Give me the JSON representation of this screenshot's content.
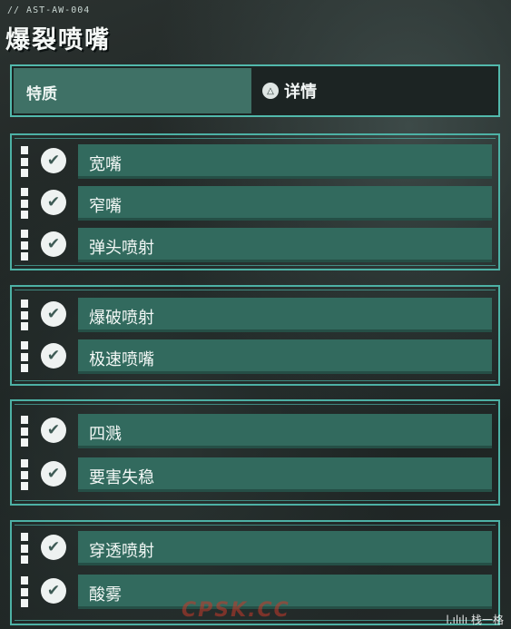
{
  "header": {
    "code": "// AST-AW-004",
    "title": "爆裂喷嘴"
  },
  "tabs": {
    "traits": "特质",
    "details_button_icon": "triangle-icon",
    "details_button_glyph": "△",
    "details": "详情"
  },
  "groups": [
    {
      "items": [
        "宽嘴",
        "窄嘴",
        "弹头喷射"
      ]
    },
    {
      "items": [
        "爆破喷射",
        "极速喷嘴"
      ]
    },
    {
      "items": [
        "四溅",
        "要害失稳"
      ]
    },
    {
      "items": [
        "穿透喷射",
        "酸雾"
      ]
    }
  ],
  "check_glyph": "✔",
  "watermark": "CPSK.CC",
  "corner_text": "l.ılılı 栈一格"
}
